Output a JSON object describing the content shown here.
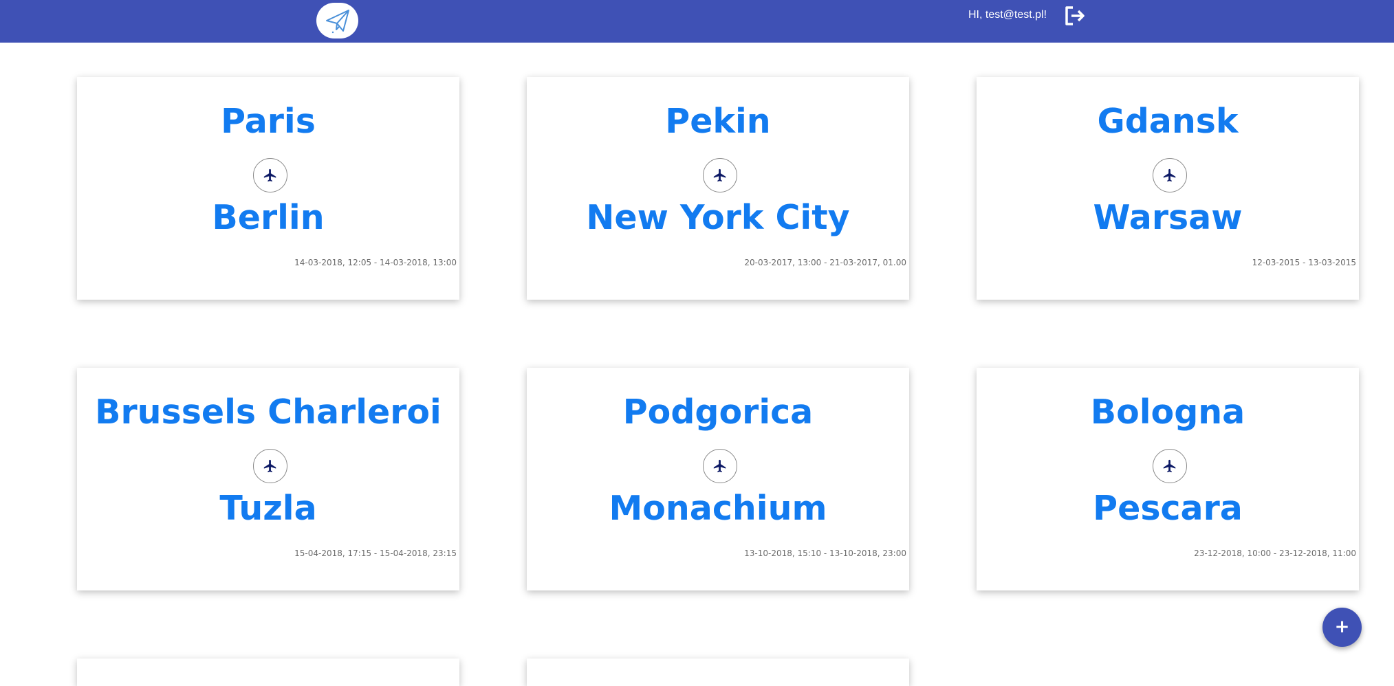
{
  "header": {
    "logo_icon": "paper-plane-icon",
    "greeting": "HI, test@test.pl!",
    "logout_icon": "logout-icon",
    "background_color": "#3f51b5"
  },
  "trips": [
    {
      "from": "Paris",
      "to": "Berlin",
      "dates": "14-03-2018, 12:05 - 14-03-2018, 13:00"
    },
    {
      "from": "Pekin",
      "to": "New York City",
      "dates": "20-03-2017, 13:00 - 21-03-2017, 01.00"
    },
    {
      "from": "Gdansk",
      "to": "Warsaw",
      "dates": "12-03-2015 - 13-03-2015"
    },
    {
      "from": "Brussels Charleroi",
      "to": "Tuzla",
      "dates": "15-04-2018, 17:15 - 15-04-2018, 23:15"
    },
    {
      "from": "Podgorica",
      "to": "Monachium",
      "dates": "13-10-2018, 15:10 - 13-10-2018, 23:00"
    },
    {
      "from": "Bologna",
      "to": "Pescara",
      "dates": "23-12-2018, 10:00 - 23-12-2018, 11:00"
    }
  ],
  "trip_icon": "airplane-icon",
  "accent_color": "#127bf0",
  "fab": {
    "label": "+",
    "icon": "plus-icon"
  }
}
